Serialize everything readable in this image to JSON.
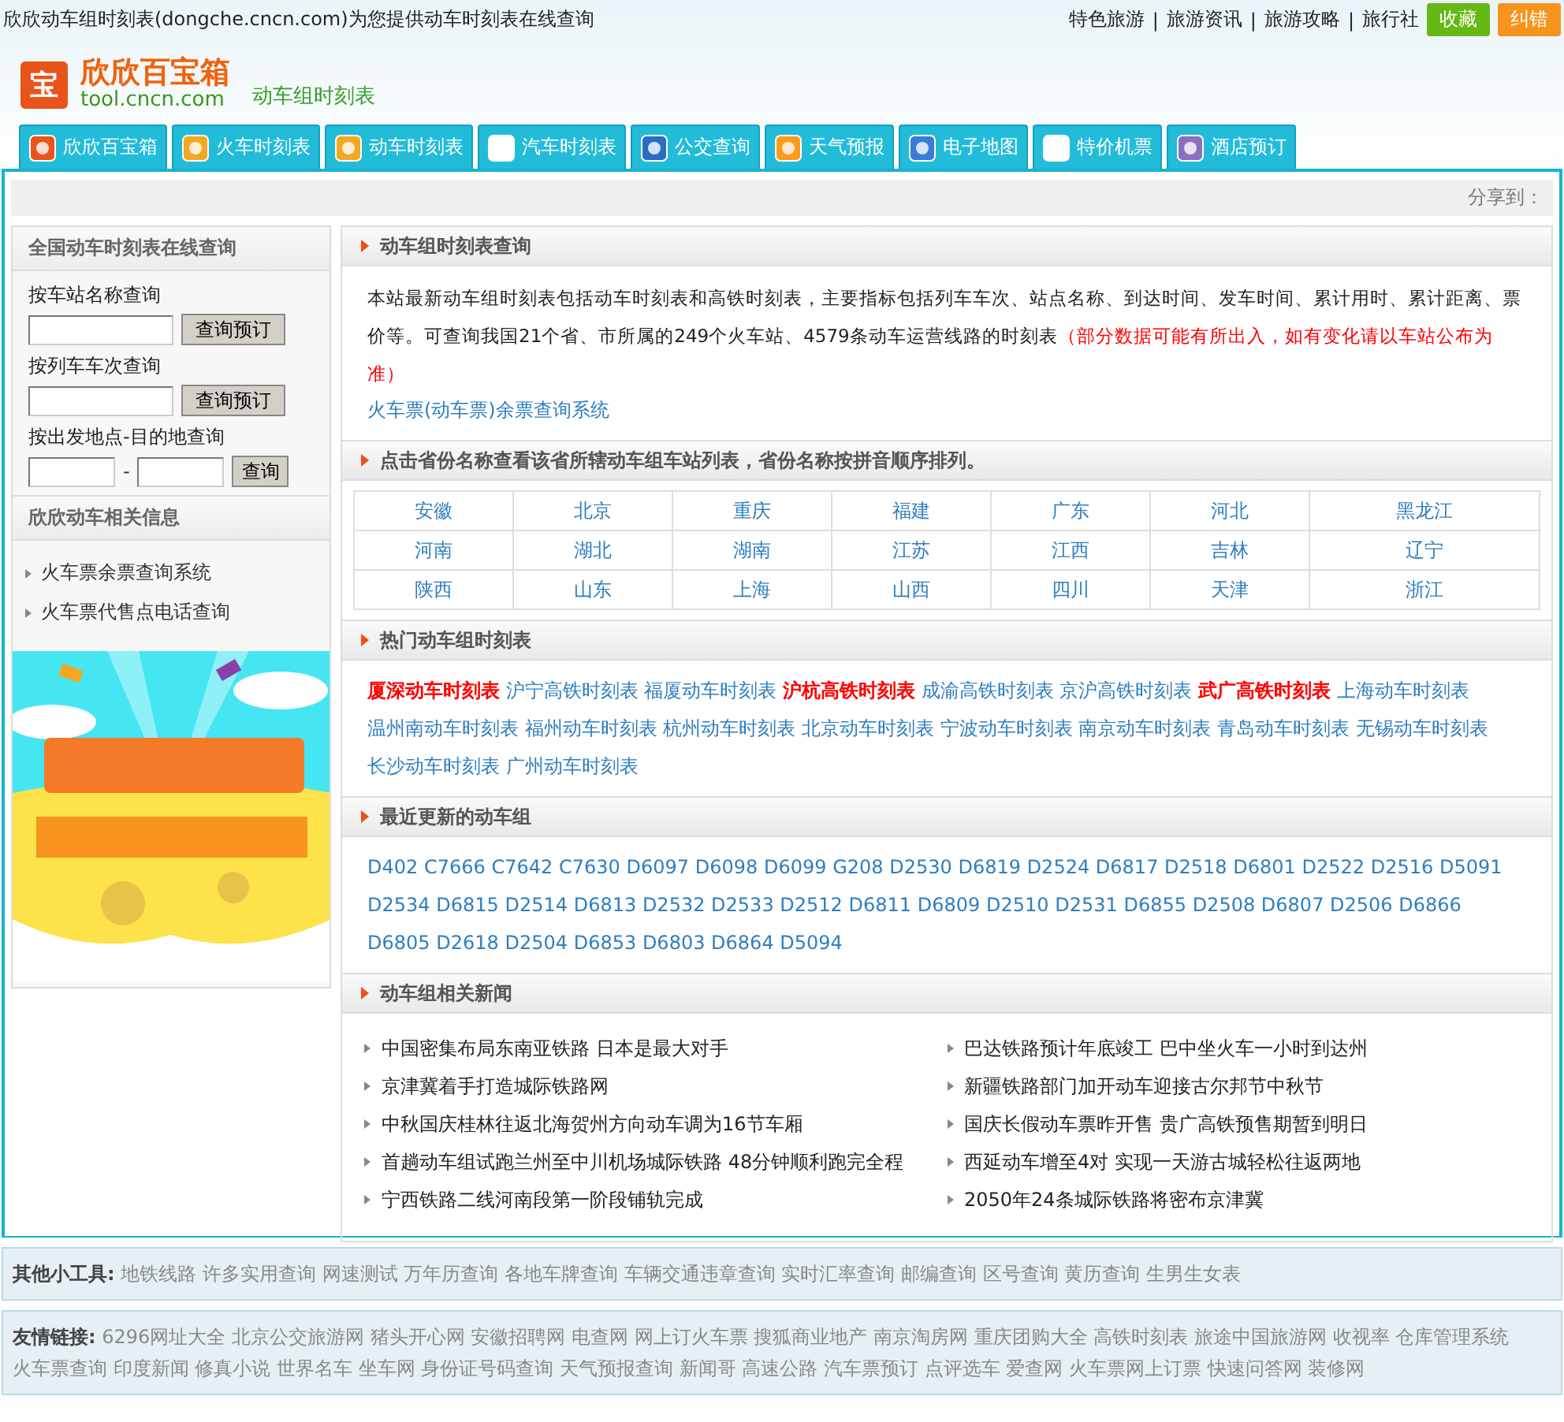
{
  "topbar": {
    "title": "欣欣动车组时刻表(dongche.cncn.com)为您提供动车时刻表在线查询",
    "links": [
      "特色旅游",
      "旅游资讯",
      "旅游攻略",
      "旅行社"
    ],
    "separator": "|",
    "buttons": [
      {
        "label": "收藏",
        "color": "#66b814"
      },
      {
        "label": "纠错",
        "color": "#f7941d"
      }
    ]
  },
  "logo": {
    "mark": "宝",
    "name": "欣欣百宝箱",
    "domain": "tool.cncn.com",
    "subtitle": "动车组时刻表"
  },
  "tabs": [
    "欣欣百宝箱",
    "火车时刻表",
    "动车时刻表",
    "汽车时刻表",
    "公交查询",
    "天气预报",
    "电子地图",
    "特价机票",
    "酒店预订"
  ],
  "share": "分享到：",
  "sidebar": {
    "search_title": "全国动车时刻表在线查询",
    "station": {
      "label": "按车站名称查询",
      "button": "查询预订"
    },
    "train": {
      "label": "按列车车次查询",
      "button": "查询预订"
    },
    "route": {
      "label": "按出发地点-目的地查询",
      "separator": "-",
      "button": "查询"
    },
    "info_title": "欣欣动车相关信息",
    "info_links": [
      "火车票余票查询系统",
      "火车票代售点电话查询"
    ],
    "banner": {
      "kind": "picture"
    }
  },
  "intro": {
    "title": "动车组时刻表查询",
    "text": "本站最新动车组时刻表包括动车时刻表和高铁时刻表，主要指标包括列车车次、站点名称、到达时间、发车时间、累计用时、累计距离、票价等。可查询我国21个省、市所属的249个火车站、4579条动车运营线路的时刻表",
    "notice": "（部分数据可能有所出入，如有变化请以车站公布为准）",
    "link": "火车票(动车票)余票查询系统"
  },
  "provinces": {
    "title": "点击省份名称查看该省所辖动车组车站列表，省份名称按拼音顺序排列。",
    "rows": [
      [
        "安徽",
        "北京",
        "重庆",
        "福建",
        "广东",
        "河北",
        "黑龙江"
      ],
      [
        "河南",
        "湖北",
        "湖南",
        "江苏",
        "江西",
        "吉林",
        "辽宁"
      ],
      [
        "陕西",
        "山东",
        "上海",
        "山西",
        "四川",
        "天津",
        "浙江"
      ]
    ]
  },
  "hot": {
    "title": "热门动车组时刻表",
    "links": [
      {
        "label": "厦深动车时刻表",
        "featured": true
      },
      {
        "label": "沪宁高铁时刻表",
        "featured": false
      },
      {
        "label": "福厦动车时刻表",
        "featured": false
      },
      {
        "label": "沪杭高铁时刻表",
        "featured": true
      },
      {
        "label": "成渝高铁时刻表",
        "featured": false
      },
      {
        "label": "京沪高铁时刻表",
        "featured": false
      },
      {
        "label": "武广高铁时刻表",
        "featured": true
      },
      {
        "label": "上海动车时刻表",
        "featured": false
      },
      {
        "label": "温州南动车时刻表",
        "featured": false
      },
      {
        "label": "福州动车时刻表",
        "featured": false
      },
      {
        "label": "杭州动车时刻表",
        "featured": false
      },
      {
        "label": "北京动车时刻表",
        "featured": false
      },
      {
        "label": "宁波动车时刻表",
        "featured": false
      },
      {
        "label": "南京动车时刻表",
        "featured": false
      },
      {
        "label": "青岛动车时刻表",
        "featured": false
      },
      {
        "label": "无锡动车时刻表",
        "featured": false
      },
      {
        "label": "长沙动车时刻表",
        "featured": false
      },
      {
        "label": "广州动车时刻表",
        "featured": false
      }
    ]
  },
  "recent": {
    "title": "最近更新的动车组",
    "trains": [
      "D402",
      "C7666",
      "C7642",
      "C7630",
      "D6097",
      "D6098",
      "D6099",
      "G208",
      "D2530",
      "D6819",
      "D2524",
      "D6817",
      "D2518",
      "D6801",
      "D2522",
      "D2516",
      "D5091",
      "D2534",
      "D6815",
      "D2514",
      "D6813",
      "D2532",
      "D2533",
      "D2512",
      "D6811",
      "D6809",
      "D2510",
      "D2531",
      "D6855",
      "D2508",
      "D6807",
      "D2506",
      "D6866",
      "D6805",
      "D2618",
      "D2504",
      "D6853",
      "D6803",
      "D6864",
      "D5094"
    ]
  },
  "news": {
    "title": "动车组相关新闻",
    "items": [
      "中国密集布局东南亚铁路 日本是最大对手",
      "巴达铁路预计年底竣工 巴中坐火车一小时到达州",
      "京津冀着手打造城际铁路网",
      "新疆铁路部门加开动车迎接古尔邦节中秋节",
      "中秋国庆桂林往返北海贺州方向动车调为16节车厢",
      "国庆长假动车票昨开售 贵广高铁预售期暂到明日",
      "首趟动车组试跑兰州至中川机场城际铁路 48分钟顺利跑完全程",
      "西延动车增至4对 实现一天游古城轻松往返两地",
      "宁西铁路二线河南段第一阶段铺轨完成",
      "2050年24条城际铁路将密布京津冀"
    ]
  },
  "tools": {
    "label": "其他小工具:",
    "links": [
      "地铁线路",
      "许多实用查询",
      "网速测试",
      "万年历查询",
      "各地车牌查询",
      "车辆交通违章查询",
      "实时汇率查询",
      "邮编查询",
      "区号查询",
      "黄历查询",
      "生男生女表"
    ]
  },
  "friends": {
    "label": "友情链接:",
    "links": [
      "6296网址大全",
      "北京公交旅游网",
      "猪头开心网",
      "安徽招聘网",
      "电查网",
      "网上订火车票",
      "搜狐商业地产",
      "南京淘房网",
      "重庆团购大全",
      "高铁时刻表",
      "旅途中国旅游网",
      "收视率",
      "仓库管理系统",
      "火车票查询",
      "印度新闻",
      "修真小说",
      "世界名车",
      "坐车网",
      "身份证号码查询",
      "天气预报查询",
      "新闻哥",
      "高速公路",
      "汽车票预订",
      "点评选车",
      "爱查网",
      "火车票网上订票",
      "快速问答网",
      "装修网"
    ]
  }
}
